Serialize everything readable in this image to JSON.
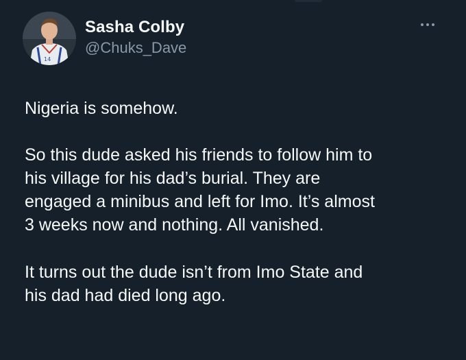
{
  "author": {
    "display_name": "Sasha Colby",
    "handle": "@Chuks_Dave",
    "avatar_icon": "profile-photo-footballer"
  },
  "menu": {
    "more_icon": "ellipsis-icon"
  },
  "tweet": {
    "paragraph_1": "Nigeria is somehow.",
    "paragraph_2_lines": [
      "So this dude asked his friends to follow him to",
      "his village for his dad’s burial. They are",
      "engaged a minibus and left for Imo. It’s almost",
      "3 weeks now and nothing. All vanished."
    ],
    "paragraph_3_lines": [
      "It turns out the dude isn’t from Imo State and",
      "his dad had died long ago."
    ]
  },
  "colors": {
    "background": "#15202b",
    "text_primary": "#f7f9f9",
    "text_secondary": "#8b98a5"
  }
}
